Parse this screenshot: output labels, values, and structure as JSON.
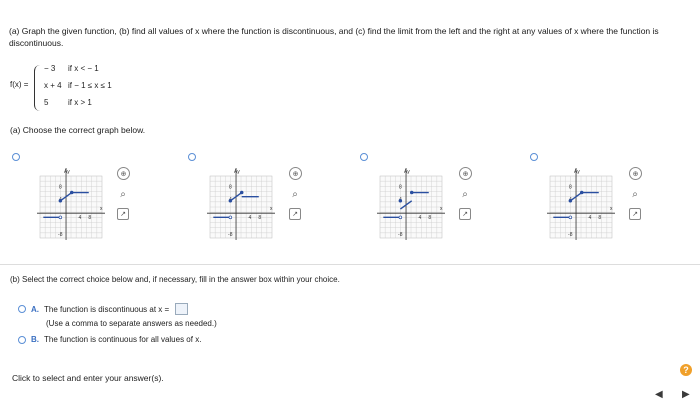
{
  "question": {
    "prompt": "(a) Graph the given function, (b) find all values of x where the function is discontinuous, and (c) find the limit from the left and the right at any values of x where the function is discontinuous.",
    "function_label": "f(x) =",
    "cases": [
      {
        "expr": "− 3",
        "cond": "if x < − 1"
      },
      {
        "expr": "x + 4",
        "cond": "if − 1 ≤ x ≤ 1"
      },
      {
        "expr": "5",
        "cond": "if x > 1"
      }
    ]
  },
  "part_a": {
    "label": "(a) Choose the correct graph below.",
    "graph_labels": {
      "y": "Ay",
      "x": "x",
      "y_top": "8",
      "y_mid": "4",
      "x_a": "4",
      "x_b": "8",
      "y_neg": "-8"
    }
  },
  "part_b": {
    "label": "(b) Select the correct choice below and, if necessary, fill in the answer box within your choice.",
    "option_a_letter": "A.",
    "option_a_text": "The function is discontinuous at x =",
    "option_a_note": "(Use a comma to separate answers as needed.)",
    "option_b_letter": "B.",
    "option_b_text": "The function is continuous for all values of x."
  },
  "footer": {
    "instruction": "Click to select and enter your answer(s).",
    "help": "?",
    "prev": "◀",
    "next": "▶"
  },
  "colors": {
    "accent": "#3a6fc1",
    "radio": "#5b8fd6",
    "help": "#f0a02a"
  }
}
